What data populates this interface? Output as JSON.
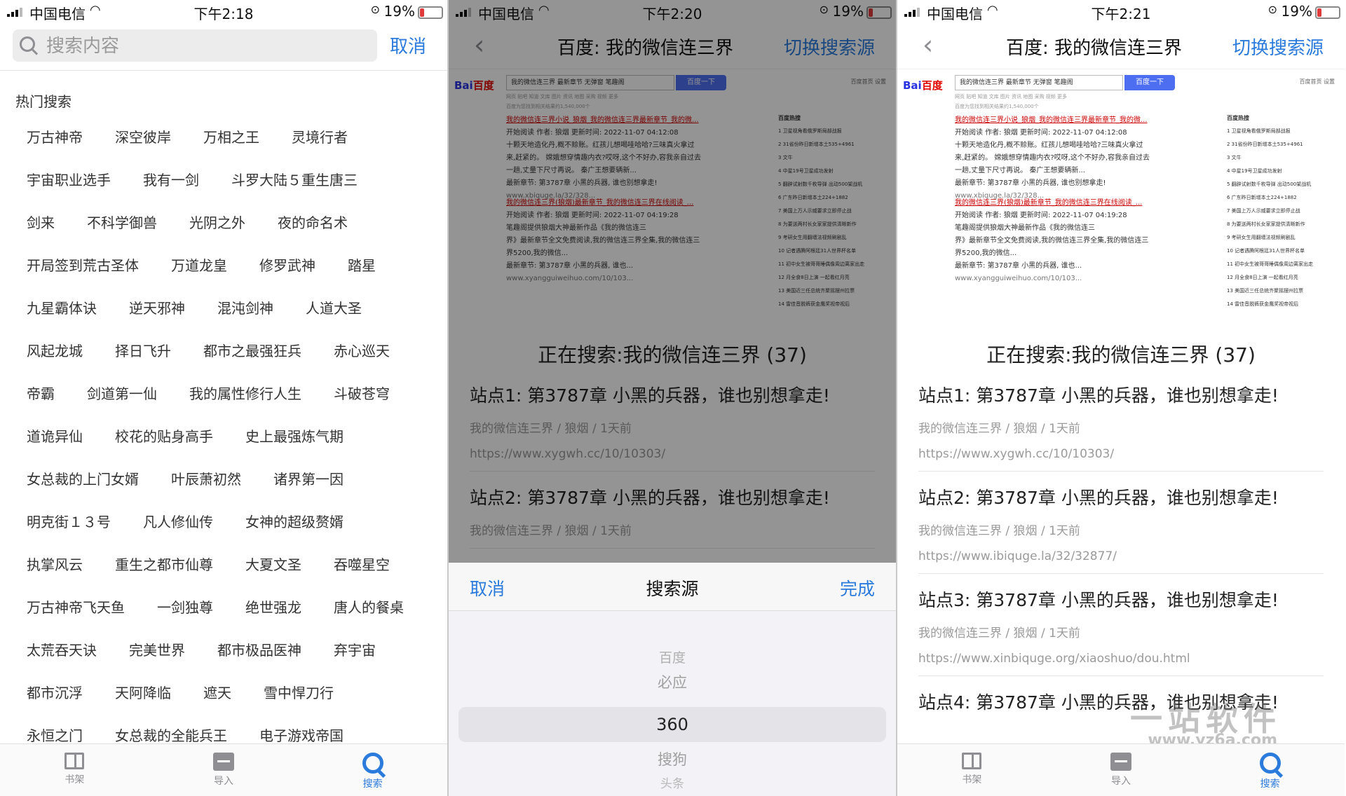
{
  "status": [
    {
      "carrier": "中国电信",
      "time": "下午2:18",
      "battery": "19%"
    },
    {
      "carrier": "中国电信",
      "time": "下午2:20",
      "battery": "19%"
    },
    {
      "carrier": "中国电信",
      "time": "下午2:21",
      "battery": "19%"
    }
  ],
  "search": {
    "placeholder": "搜索内容",
    "cancel": "取消"
  },
  "hot": {
    "title": "热门搜索",
    "rows": [
      [
        "万古神帝",
        "深空彼岸",
        "万相之王",
        "灵境行者"
      ],
      [
        "宇宙职业选手",
        "我有一剑",
        "斗罗大陆５重生唐三"
      ],
      [
        "剑来",
        "不科学御兽",
        "光阴之外",
        "夜的命名术"
      ],
      [
        "开局签到荒古圣体",
        "万道龙皇",
        "修罗武神",
        "踏星"
      ],
      [
        "九星霸体诀",
        "逆天邪神",
        "混沌剑神",
        "人道大圣"
      ],
      [
        "风起龙城",
        "择日飞升",
        "都市之最强狂兵",
        "赤心巡天"
      ],
      [
        "帝霸",
        "剑道第一仙",
        "我的属性修行人生",
        "斗破苍穹"
      ],
      [
        "道诡异仙",
        "校花的贴身高手",
        "史上最强炼气期"
      ],
      [
        "女总裁的上门女婿",
        "叶辰萧初然",
        "诸界第一因"
      ],
      [
        "明克街１３号",
        "凡人修仙传",
        "女神的超级赘婿"
      ],
      [
        "执掌风云",
        "重生之都市仙尊",
        "大夏文圣",
        "吞噬星空"
      ],
      [
        "万古神帝飞天鱼",
        "一剑独尊",
        "绝世强龙",
        "唐人的餐桌"
      ],
      [
        "太荒吞天诀",
        "完美世界",
        "都市极品医神",
        "弃宇宙"
      ],
      [
        "都市沉浮",
        "天阿降临",
        "遮天",
        "雪中悍刀行"
      ],
      [
        "永恒之门",
        "女总裁的全能兵王",
        "电子游戏帝国"
      ]
    ]
  },
  "tabs": {
    "shelf": "书架",
    "import": "导入",
    "search": "搜索"
  },
  "nav": {
    "title": "百度: 我的微信连三界",
    "switch": "切换搜索源"
  },
  "web": {
    "logo_bai": "Bai",
    "logo_du": "百度",
    "query": "我的微信连三界 最新章节 无弹窗 笔趣阁",
    "button": "百度一下",
    "top_links": "百度首页   设置",
    "tabs": "网页  贴吧  知道  文库  图片  资讯  地图  采购  视频  更多",
    "count": "百度为您找到相关结果约1,540,000个",
    "results": [
      {
        "title": "我的微信连三界小说_狼烟_我的微信连三界最新章节_我的微...",
        "line1": "开始阅读   作者: 狼烟   更新时间: 2022-11-07 04:12:08",
        "line2": "十颗天地造化丹,概不赊账。红孩儿想喝哇哈哈?三味真火拿过",
        "line3": "来,赶紧的。 嫦娥想穿情趣内衣?哎呀,这个不好办,容我亲自过去",
        "line4": "一趟,丈量下尺寸再说。 秦广王想要辆新...",
        "line5": "最新章节: 第3787章 小黑的兵器, 谁也别想拿走!",
        "url": "www.xbiquge.la/32/328..."
      },
      {
        "title": "我的微信连三界(狼烟)最新章节_我的微信连三界在线阅读_...",
        "line1": "开始阅读   作者: 狼烟   更新时间: 2022-11-07 04:19:28",
        "line2": "笔趣阁提供狼烟大神最新作品《我的微信连三",
        "line3": "界》最新章节全文免费阅读,我的微信连三界全集,我的微信连三",
        "line4": "界5200,我的微信...",
        "line5": "最新章节: 第3787章 小黑的兵器, 谁也...",
        "url": "www.xyangguiweihuo.com/10/103..."
      }
    ],
    "side_title": "百度热搜",
    "side": [
      "1 卫星视角看俄罗斯局部战报",
      "2 31省份昨日新增本土535+4961",
      "3 文牛",
      "4 中星19号卫星成功发射",
      "5 翻辟试射数千枚导弹 出动500架战机",
      "6 广东昨日新增本土224+1882",
      "7 美国上万人示威要求立即停止战",
      "8 为要送两村长女家家提供清晰新作",
      "9 考研女生用翻墙法视频刷剧乱",
      "10 记者遇腾阿根廷31人世界杯名单",
      "11 初中女生被哥哥睡偶像周边离家出走",
      "12 月全食8日上演 一起看红月亮",
      "13 美国近三任总统齐聚摇摆州拉票",
      "14 雷佳音脱裤获金鹰奖视帝视后"
    ]
  },
  "searching": "正在搜索:我的微信连三界 (37)",
  "results": [
    {
      "title": "站点1: 第3787章 小黑的兵器，谁也别想拿走!",
      "meta": "我的微信连三界 / 狼烟 /  1天前",
      "url": "https://www.xygwh.cc/10/10303/"
    },
    {
      "title": "站点2: 第3787章 小黑的兵器，谁也别想拿走!",
      "meta": "我的微信连三界 / 狼烟 /  1天前",
      "url": "https://www.ibiquge.la/32/32877/"
    },
    {
      "title": "站点3: 第3787章 小黑的兵器，谁也别想拿走!",
      "meta": "我的微信连三界 / 狼烟 /  1天前",
      "url": "https://www.xinbiquge.org/xiaoshuo/dou.html"
    },
    {
      "title": "站点4: 第3787章 小黑的兵器，谁也别想拿走!",
      "meta": "",
      "url": ""
    }
  ],
  "sheet": {
    "cancel": "取消",
    "title": "搜索源",
    "done": "完成",
    "options": [
      "百度",
      "必应",
      "360",
      "搜狗",
      "头条"
    ],
    "selected": "360"
  },
  "watermark": {
    "line1": "一站软件",
    "line2": "www.yz6a.com"
  }
}
